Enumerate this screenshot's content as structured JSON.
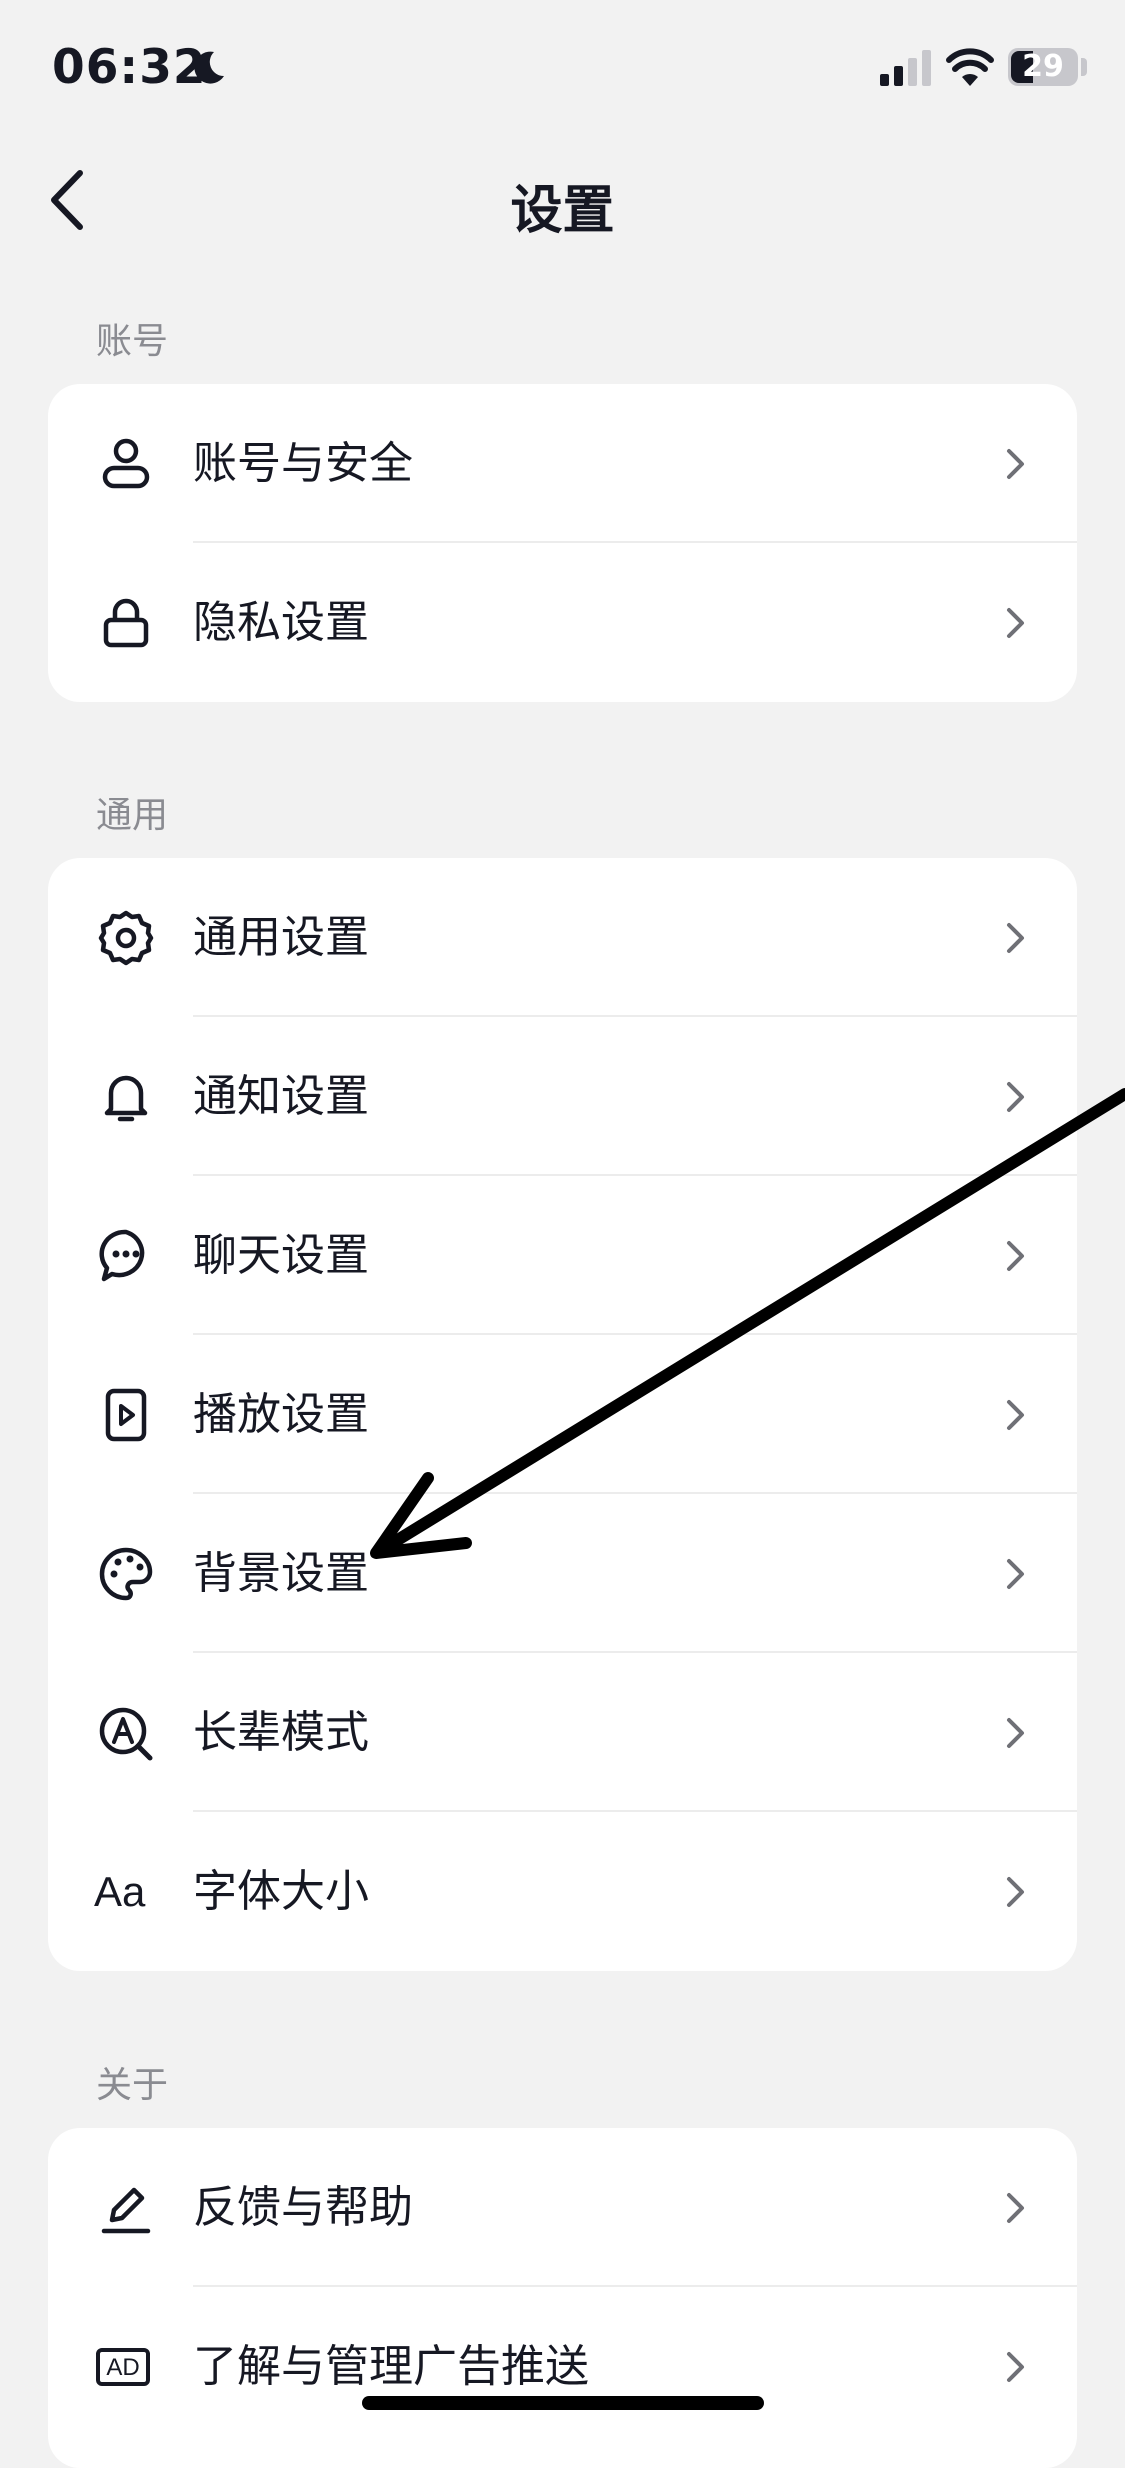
{
  "status_bar": {
    "time": "06:32",
    "battery": "29"
  },
  "header": {
    "title": "设置"
  },
  "sections": [
    {
      "label": "账号",
      "items": [
        {
          "label": "账号与安全",
          "icon": "person-icon"
        },
        {
          "label": "隐私设置",
          "icon": "lock-icon"
        }
      ]
    },
    {
      "label": "通用",
      "items": [
        {
          "label": "通用设置",
          "icon": "gear-icon"
        },
        {
          "label": "通知设置",
          "icon": "bell-icon"
        },
        {
          "label": "聊天设置",
          "icon": "chat-icon"
        },
        {
          "label": "播放设置",
          "icon": "play-icon"
        },
        {
          "label": "背景设置",
          "icon": "palette-icon"
        },
        {
          "label": "长辈模式",
          "icon": "elder-mode-icon"
        },
        {
          "label": "字体大小",
          "icon": "font-size-icon",
          "icon_text": "Aa"
        }
      ]
    },
    {
      "label": "关于",
      "items": [
        {
          "label": "反馈与帮助",
          "icon": "pencil-icon"
        },
        {
          "label": "了解与管理广告推送",
          "icon": "ad-icon",
          "icon_text": "AD"
        }
      ]
    }
  ],
  "colors": {
    "background": "#f2f2f2",
    "card": "#ffffff",
    "text": "#161823",
    "secondary": "#8a8b91",
    "annotation_arrow": "#000000"
  }
}
